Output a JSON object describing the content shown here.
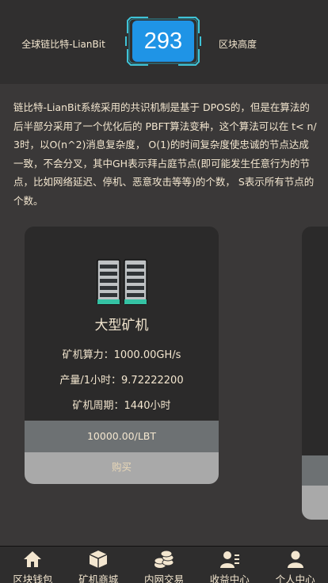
{
  "header": {
    "left_label": "全球链比特-LianBit",
    "block_height": "293",
    "right_label": "区块高度"
  },
  "description": "链比特-LianBit系统采用的共识机制是基于 DPOS的，但是在算法的后半部分采用了一个优化后的 PBFT算法变种，这个算法可以在 t< n/ 3时，以O(n^2)消息复杂度， O(1)的时间复杂度使忠诚的节点达成一致，不会分叉，其中GH表示拜占庭节点(即可能发生任意行为的节点，比如网络延迟、停机、恶意攻击等等)的个数， S表示所有节点的个数。",
  "cards": [
    {
      "title": "大型矿机",
      "hashrate": "矿机算力：1000.00GH/s",
      "output": "产量/1小时：9.72222200",
      "period": "矿机周期：1440小时",
      "price": "10000.00/LBT",
      "buy_label": "购买"
    }
  ],
  "nav": [
    {
      "label": "区块钱包",
      "icon": "home-icon"
    },
    {
      "label": "矿机商城",
      "icon": "box-icon"
    },
    {
      "label": "内网交易",
      "icon": "coins-icon"
    },
    {
      "label": "收益中心",
      "icon": "users-icon"
    },
    {
      "label": "个人中心",
      "icon": "user-icon"
    }
  ],
  "colors": {
    "background": "#3a3838",
    "header": "#302f2f",
    "text": "#f3e6cf",
    "accent": "#1f94e6",
    "frame": "#3fc3d6"
  }
}
